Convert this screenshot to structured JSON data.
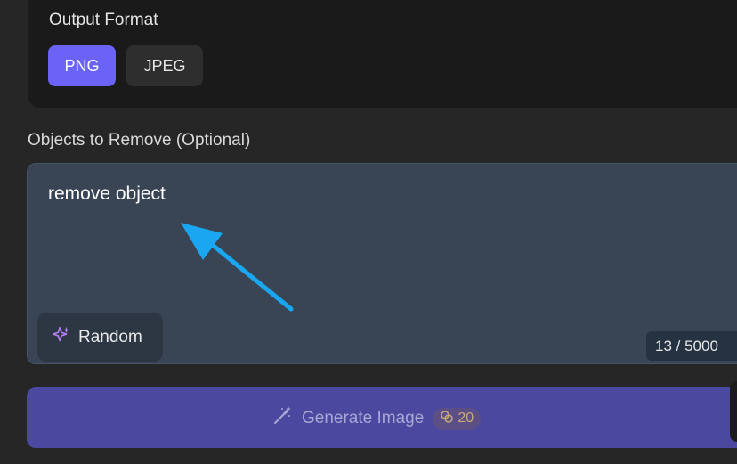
{
  "output_format": {
    "label": "Output Format",
    "options": [
      "PNG",
      "JPEG"
    ],
    "selected": "PNG"
  },
  "objects": {
    "label": "Objects to Remove (Optional)",
    "value": "remove object",
    "counter": "13 / 5000",
    "random_label": "Random"
  },
  "generate": {
    "label": "Generate Image",
    "credits": "20"
  },
  "colors": {
    "accent": "#6a63f6",
    "generate_bg": "#4b48a0",
    "annotation_arrow": "#1aa6f0"
  },
  "icons": [
    "sparkles-icon",
    "magic-wand-icon",
    "coins-icon",
    "pointer-arrow-annotation"
  ]
}
